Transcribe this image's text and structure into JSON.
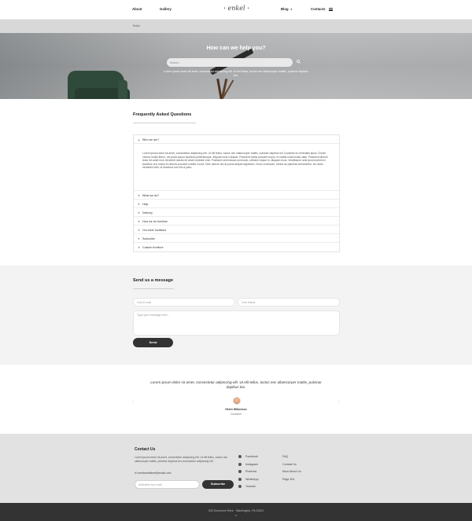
{
  "header": {
    "nav_left": [
      "About",
      "Gallery"
    ],
    "logo": "enkel",
    "nav_right": [
      "Blog",
      "Contacts"
    ],
    "blog_caret": "▼"
  },
  "breadcrumb": "Enkel",
  "hero": {
    "title": "How can we help you?",
    "search_placeholder": "Search...",
    "subtitle": "Lorem ipsum dolor sit amet, consectetur adipiscing elit. Ut elit tellus, luctus nec ullamcorper mattis, pulvinar dapibus leo."
  },
  "faq": {
    "title": "Frequently Asked Questions",
    "open_item": "Who we are?",
    "open_body": "Lorem ipsum dolor sit amet, consectetur adipiscing elit. Ut elit tellus, luctus nec ullamcorper mattis, pulvinar dapibus leo.Curabitur id venenatis lacus. Donec viverra mollis libero, vel porta ipsum faucibus pellentesque. Aliquam erat volutpat. Praesent mollis posuere turpis, et mattis nulla mollis vitae. Praesent dictum dolor sit amet eros hendrerit iaculis sit amet molestie erat. Praesent sed massa commodo, ultricies neque in, aliquam risus. Vestibulum ante ipsum primis in faucibus orci luctus et ultrices posuere cubilia Curae; Duis dictum dui at purus aliquet dignissim. Nunc commodo, metus ac placerat consectetur, leo diam hendrerit nibh, id tincidunt orci elit ut justo.",
    "items": [
      "What we do?",
      "Help",
      "Delivery",
      "How we do furniture",
      "Our store locations",
      "Subscribe",
      "Custom furniture"
    ]
  },
  "message": {
    "title": "Send us a message",
    "email_placeholder": "Your E-mail",
    "name_placeholder": "Your Name",
    "message_placeholder": "Type your message here...",
    "send_label": "Send"
  },
  "testimonial": {
    "quote": "Lorem ipsum dolor sit amet, consectetur adipiscing elit. Ut elit tellus, luctus nec ullamcorper mattis, pulvinar dapibus leo.",
    "name": "Helen Wilkerson",
    "role": "Customer",
    "prev": "‹",
    "next": "›"
  },
  "footer": {
    "contact_title": "Contact Us",
    "contact_text": "Lorem ipsum dolor sit amet, consectetur adipiscing elit. Ut elit tellus, luctus nec ullamcorper mattis, pulvinar dapibus leo consectetur adipiscing elit.",
    "email": "furniturebellnet@email.com",
    "subscribe_placeholder": "Subscribe by e-mail",
    "subscribe_label": "Subscribe",
    "social": [
      "Facebook",
      "Instagram",
      "Pinterest",
      "WhatsApp",
      "Youtube"
    ],
    "links": [
      "FAQ",
      "Contact Us",
      "More About Us",
      "Page 404"
    ],
    "address": "325 Dunsmore Drive · Washington, PA 15301",
    "scroll_top": "⌃"
  },
  "colors": {
    "dark": "#333333",
    "footer_bg": "#e2e2e2",
    "section_bg": "#f3f3f3"
  }
}
